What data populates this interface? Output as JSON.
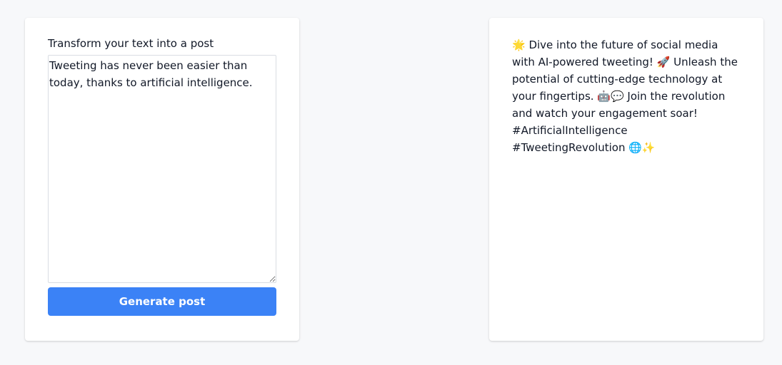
{
  "input_panel": {
    "label": "Transform your text into a post",
    "input_value": "Tweeting has never been easier than today, thanks to artificial intelligence.",
    "button_label": "Generate post",
    "button_color": "#3b82f6"
  },
  "output_panel": {
    "generated_post": "🌟 Dive into the future of social media with AI-powered tweeting! 🚀 Unleash the potential of cutting-edge technology at your fingertips. 🤖💬 Join the revolution and watch your engagement soar! #ArtificialIntelligence #TweetingRevolution 🌐✨"
  }
}
